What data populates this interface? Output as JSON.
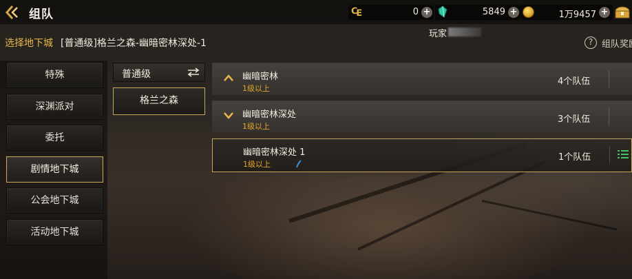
{
  "header": {
    "title": "组队",
    "currencies": [
      {
        "icon": "c-coin-icon",
        "value": "0"
      },
      {
        "icon": "green-gem-icon",
        "value": "5849"
      },
      {
        "icon": "gold-coin-icon",
        "value": "1万9457"
      }
    ]
  },
  "subheader": {
    "label": "选择地下城",
    "path": "[普通级]格兰之森-幽暗密林深处-1",
    "player": "玩家",
    "reward": "组队奖励"
  },
  "categories": [
    {
      "label": "特殊",
      "active": false
    },
    {
      "label": "深渊派对",
      "active": false
    },
    {
      "label": "委托",
      "active": false
    },
    {
      "label": "剧情地下城",
      "active": true
    },
    {
      "label": "公会地下城",
      "active": false
    },
    {
      "label": "活动地下城",
      "active": false
    }
  ],
  "difficulty": {
    "selected": "普通级",
    "map": "格兰之森"
  },
  "dungeons": [
    {
      "name": "幽暗密林",
      "level": "1级以上",
      "teams": "4个队伍",
      "chevron": "up-chevron-icon",
      "selected": false
    },
    {
      "name": "幽暗密林深处",
      "level": "1级以上",
      "teams": "3个队伍",
      "chevron": "down-chevron-icon",
      "selected": false
    },
    {
      "name": "幽暗密林深处 1",
      "level": "1级以上",
      "teams": "1个队伍",
      "chevron": "",
      "selected": true
    }
  ],
  "colors": {
    "accent_gold": "#c9a75a",
    "level_orange": "#e3a728",
    "label_gold": "#e8b64a"
  }
}
